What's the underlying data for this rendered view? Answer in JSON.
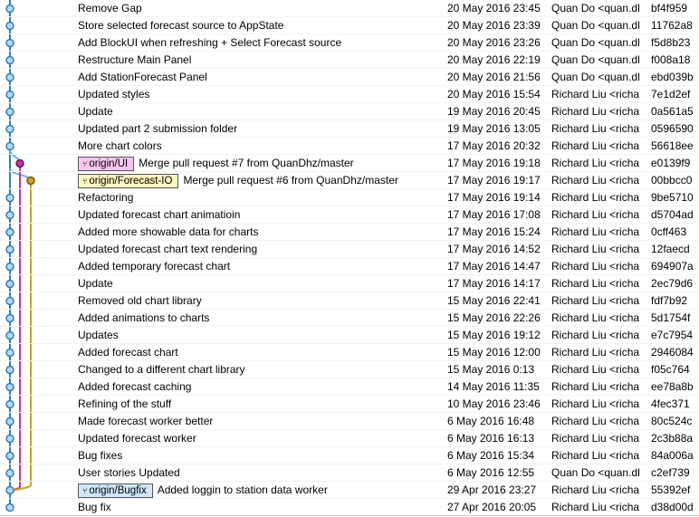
{
  "colors": {
    "lane_main": "#2e7fb8",
    "lane_ui": "#c0389a",
    "lane_forecast": "#c9a227",
    "lane_branch": "#6fb0e0",
    "badge_ui_bg": "#f5c6ec",
    "badge_forecast_bg": "#fdf3c0",
    "badge_bugfix_bg": "#cde8fb"
  },
  "commits": [
    {
      "message": "Remove Gap",
      "date": "20 May 2016 23:45",
      "author": "Quan Do <quan.dl",
      "hash": "bf4f959",
      "badge": null
    },
    {
      "message": "Store selected forecast source to AppState",
      "date": "20 May 2016 23:39",
      "author": "Quan Do <quan.dl",
      "hash": "11762a8",
      "badge": null
    },
    {
      "message": "Add BlockUI when refreshing + Select Forecast source",
      "date": "20 May 2016 23:26",
      "author": "Quan Do <quan.dl",
      "hash": "f5d8b23",
      "badge": null
    },
    {
      "message": "Restructure Main Panel",
      "date": "20 May 2016 22:19",
      "author": "Quan Do <quan.dl",
      "hash": "f008a18",
      "badge": null
    },
    {
      "message": "Add StationForecast Panel",
      "date": "20 May 2016 21:56",
      "author": "Quan Do <quan.dl",
      "hash": "ebd039b",
      "badge": null
    },
    {
      "message": "Updated styles",
      "date": "20 May 2016 15:54",
      "author": "Richard Liu <richa",
      "hash": "7e1d2ef",
      "badge": null
    },
    {
      "message": "Update",
      "date": "19 May 2016 20:45",
      "author": "Richard Liu <richa",
      "hash": "0a561a5",
      "badge": null
    },
    {
      "message": "Updated part 2 submission folder",
      "date": "19 May 2016 13:05",
      "author": "Richard Liu <richa",
      "hash": "0596590",
      "badge": null
    },
    {
      "message": "More chart colors",
      "date": "17 May 2016 20:32",
      "author": "Richard Liu <richa",
      "hash": "56618ee",
      "badge": null
    },
    {
      "message": "Merge pull request #7 from QuanDhz/master",
      "date": "17 May 2016 19:18",
      "author": "Richard Liu <richa",
      "hash": "e0139f9",
      "badge": "origin/UI"
    },
    {
      "message": "Merge pull request #6 from QuanDhz/master",
      "date": "17 May 2016 19:17",
      "author": "Richard Liu <richa",
      "hash": "00bbcc0",
      "badge": "origin/Forecast-IO"
    },
    {
      "message": "Refactoring",
      "date": "17 May 2016 19:14",
      "author": "Richard Liu <richa",
      "hash": "9be5710",
      "badge": null
    },
    {
      "message": "Updated forecast chart animatioin",
      "date": "17 May 2016 17:08",
      "author": "Richard Liu <richa",
      "hash": "d5704ad",
      "badge": null
    },
    {
      "message": "Added more showable data for charts",
      "date": "17 May 2016 15:24",
      "author": "Richard Liu <richa",
      "hash": "0cff463",
      "badge": null
    },
    {
      "message": "Updated forecast chart text rendering",
      "date": "17 May 2016 14:52",
      "author": "Richard Liu <richa",
      "hash": "12faecd",
      "badge": null
    },
    {
      "message": "Added temporary forecast chart",
      "date": "17 May 2016 14:47",
      "author": "Richard Liu <richa",
      "hash": "694907a",
      "badge": null
    },
    {
      "message": "Update",
      "date": "17 May 2016 14:17",
      "author": "Richard Liu <richa",
      "hash": "2ec79d6",
      "badge": null
    },
    {
      "message": "Removed old chart library",
      "date": "15 May 2016 22:41",
      "author": "Richard Liu <richa",
      "hash": "fdf7b92",
      "badge": null
    },
    {
      "message": "Added animations to charts",
      "date": "15 May 2016 22:26",
      "author": "Richard Liu <richa",
      "hash": "5d1754f",
      "badge": null
    },
    {
      "message": "Updates",
      "date": "15 May 2016 19:12",
      "author": "Richard Liu <richa",
      "hash": "e7c7954",
      "badge": null
    },
    {
      "message": "Added forecast chart",
      "date": "15 May 2016 12:00",
      "author": "Richard Liu <richa",
      "hash": "2946084",
      "badge": null
    },
    {
      "message": "Changed to a different chart library",
      "date": "15 May 2016 0:13",
      "author": "Richard Liu <richa",
      "hash": "f05c764",
      "badge": null
    },
    {
      "message": "Added forecast caching",
      "date": "14 May 2016 11:35",
      "author": "Richard Liu <richa",
      "hash": "ee78a8b",
      "badge": null
    },
    {
      "message": "Refining of the stuff",
      "date": "10 May 2016 23:46",
      "author": "Richard Liu <richa",
      "hash": "4fec371",
      "badge": null
    },
    {
      "message": "Made forecast worker better",
      "date": "6 May 2016 16:48",
      "author": "Richard Liu <richa",
      "hash": "80c524c",
      "badge": null
    },
    {
      "message": "Updated forecast worker",
      "date": "6 May 2016 16:13",
      "author": "Richard Liu <richa",
      "hash": "2c3b88a",
      "badge": null
    },
    {
      "message": "Bug fixes",
      "date": "6 May 2016 15:34",
      "author": "Richard Liu <richa",
      "hash": "84a006a",
      "badge": null
    },
    {
      "message": "User stories Updated",
      "date": "6 May 2016 12:55",
      "author": "Quan Do <quan.dl",
      "hash": "c2ef739",
      "badge": null
    },
    {
      "message": "Added loggin to station data worker",
      "date": "29 Apr 2016 23:27",
      "author": "Richard Liu <richa",
      "hash": "55392ef",
      "badge": "origin/Bugfix"
    },
    {
      "message": "Bug fix",
      "date": "27 Apr 2016 20:05",
      "author": "Richard Liu <richa",
      "hash": "d38d00d",
      "badge": null
    }
  ],
  "badge_icon": "branch-icon"
}
